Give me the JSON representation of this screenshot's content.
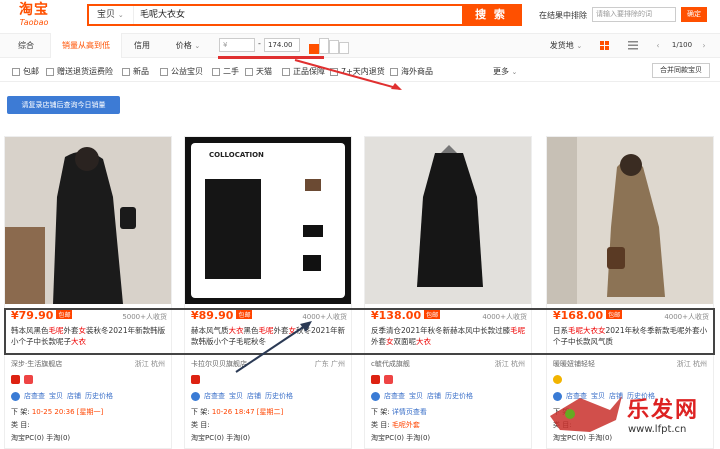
{
  "header": {
    "logo_main": "淘宝",
    "logo_sub": "Taobao",
    "search_scope": "宝贝",
    "search_query": "毛呢大衣女",
    "search_button": "搜 索",
    "exclude_label": "在结果中排除",
    "exclude_placeholder": "请输入要排除的词",
    "exclude_button": "确定"
  },
  "sortbar": {
    "items": [
      "综合",
      "销量从高到低",
      "信用",
      "价格"
    ],
    "price_min_placeholder": "¥",
    "price_max": "174.00",
    "ship_from": "发货地",
    "page": "1/100"
  },
  "filters": {
    "checkboxes": [
      "包邮",
      "赠送退货运费险",
      "新品",
      "公益宝贝",
      "二手",
      "天猫",
      "正品保障",
      "7+天内退货",
      "海外商品"
    ],
    "more": "更多",
    "merge": "合并同款宝贝"
  },
  "sales_button": "请复录店铺后查询今日销量",
  "products": [
    {
      "price": "¥79.90",
      "badge": "包邮",
      "sales": "5000+人收货",
      "title_parts": [
        [
          "韩本风黑色",
          ""
        ],
        [
          "毛呢",
          "hl"
        ],
        [
          "外套",
          ""
        ],
        [
          "女",
          "hl"
        ],
        [
          "装秋冬2021年新款韩版小个子中长款呢子",
          ""
        ],
        [
          "大衣",
          "hl"
        ]
      ],
      "shop": "深步·生活旗舰店",
      "location": "浙江 杭州",
      "line1": "下 架:",
      "line1_val": "10-25 20:36 [星期一]",
      "line2": "类 目:",
      "line2_val": "",
      "line3": "淘宝PC(0)  手淘(0)",
      "img_bg": "#c9c2ba"
    },
    {
      "price": "¥89.90",
      "badge": "包邮",
      "sales": "4000+人收货",
      "title_parts": [
        [
          "赫本风气质",
          ""
        ],
        [
          "大衣",
          "hl"
        ],
        [
          "黑色",
          ""
        ],
        [
          "毛呢",
          "hl"
        ],
        [
          "外套",
          ""
        ],
        [
          "女",
          "hl"
        ],
        [
          "秋冬2021年新款韩版小个子毛呢秋冬",
          ""
        ]
      ],
      "shop": "卡拉尔贝贝旗舰店",
      "location": "广东 广州",
      "line1": "下 架:",
      "line1_val": "10-26 18:47 [星期二]",
      "line2": "类 目:",
      "line2_val": "",
      "line3": "淘宝PC(0)  手淘(0)",
      "img_bg": "#111111",
      "collocation": "COLLOCATION"
    },
    {
      "price": "¥138.00",
      "badge": "包邮",
      "sales": "4000+人收货",
      "title_parts": [
        [
          "反季清仓2021年秋冬新赫本风中长款过膝",
          ""
        ],
        [
          "毛呢",
          "hl"
        ],
        [
          "外套",
          ""
        ],
        [
          "女",
          "hl"
        ],
        [
          "双面呢",
          ""
        ],
        [
          "大衣",
          "hl"
        ]
      ],
      "shop": "c毓代成旗舰",
      "location": "浙江 杭州",
      "line1": "下 架:",
      "line1_val": "详情页查看",
      "line2": "类 目:",
      "line2_val": "毛呢外套",
      "line3": "淘宝PC(0)  手淘(0)",
      "img_bg": "#dad8d4"
    },
    {
      "price": "¥168.00",
      "badge": "包邮",
      "sales": "4000+人收货",
      "title_parts": [
        [
          "日系",
          ""
        ],
        [
          "毛呢大衣女",
          "hl"
        ],
        [
          "2021年秋冬季新款毛呢外套小个子中长款风气质",
          ""
        ]
      ],
      "shop": "暖暖妞铺轻轻",
      "location": "浙江 杭州",
      "line1": "下 架:",
      "line1_val": "",
      "line2": "类 目:",
      "line2_val": "",
      "line3": "淘宝PC(0)  手淘(0)",
      "img_bg": "#b9a68d"
    }
  ],
  "links": [
    "店查查",
    "宝贝",
    "店铺",
    "历史价格"
  ],
  "watermark": {
    "text": "乐发网",
    "url": "www.lfpt.cn"
  },
  "colors": {
    "accent": "#ff5000",
    "price": "#ff4400",
    "link": "#3a6fc8",
    "arrow": "#e03030"
  }
}
